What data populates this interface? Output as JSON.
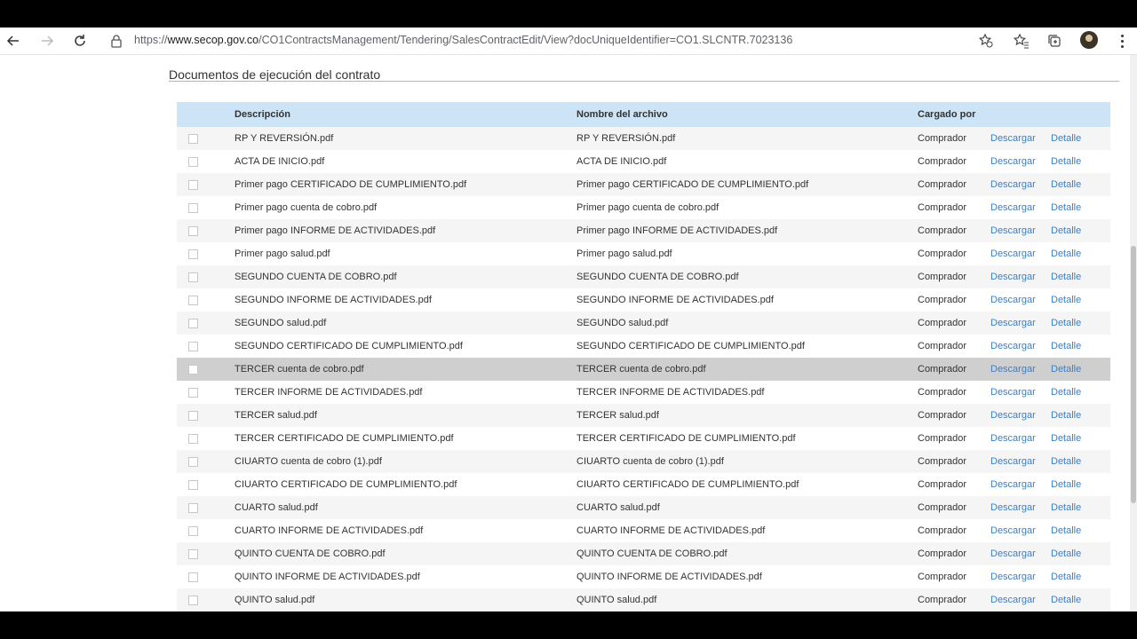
{
  "browser": {
    "url_prefix": "https://",
    "url_host": "www.secop.gov.co",
    "url_path": "/CO1ContractsManagement/Tendering/SalesContractEdit/View?docUniqueIdentifier=CO1.SLCNTR.7023136"
  },
  "section": {
    "title": "Documentos de ejecución del contrato"
  },
  "table": {
    "headers": {
      "description": "Descripción",
      "filename": "Nombre del archivo",
      "uploaded_by": "Cargado por"
    },
    "link_download": "Descargar",
    "link_detail": "Detalle",
    "rows": [
      {
        "description": "RP Y REVERSIÓN.pdf",
        "filename": "RP Y REVERSIÓN.pdf",
        "uploaded_by": "Comprador"
      },
      {
        "description": "ACTA DE INICIO.pdf",
        "filename": "ACTA DE INICIO.pdf",
        "uploaded_by": "Comprador"
      },
      {
        "description": "Primer pago CERTIFICADO DE CUMPLIMIENTO.pdf",
        "filename": "Primer pago CERTIFICADO DE CUMPLIMIENTO.pdf",
        "uploaded_by": "Comprador"
      },
      {
        "description": "Primer pago cuenta de cobro.pdf",
        "filename": "Primer pago cuenta de cobro.pdf",
        "uploaded_by": "Comprador"
      },
      {
        "description": "Primer pago INFORME DE ACTIVIDADES.pdf",
        "filename": "Primer pago INFORME DE ACTIVIDADES.pdf",
        "uploaded_by": "Comprador"
      },
      {
        "description": "Primer pago salud.pdf",
        "filename": "Primer pago salud.pdf",
        "uploaded_by": "Comprador"
      },
      {
        "description": "SEGUNDO CUENTA DE COBRO.pdf",
        "filename": "SEGUNDO CUENTA DE COBRO.pdf",
        "uploaded_by": "Comprador"
      },
      {
        "description": "SEGUNDO INFORME DE ACTIVIDADES.pdf",
        "filename": "SEGUNDO INFORME DE ACTIVIDADES.pdf",
        "uploaded_by": "Comprador"
      },
      {
        "description": "SEGUNDO salud.pdf",
        "filename": "SEGUNDO salud.pdf",
        "uploaded_by": "Comprador"
      },
      {
        "description": "SEGUNDO CERTIFICADO DE CUMPLIMIENTO.pdf",
        "filename": "SEGUNDO CERTIFICADO DE CUMPLIMIENTO.pdf",
        "uploaded_by": "Comprador"
      },
      {
        "description": "TERCER cuenta de cobro.pdf",
        "filename": "TERCER cuenta de cobro.pdf",
        "uploaded_by": "Comprador",
        "highlighted": true
      },
      {
        "description": "TERCER INFORME DE ACTIVIDADES.pdf",
        "filename": "TERCER INFORME DE ACTIVIDADES.pdf",
        "uploaded_by": "Comprador"
      },
      {
        "description": "TERCER salud.pdf",
        "filename": "TERCER salud.pdf",
        "uploaded_by": "Comprador"
      },
      {
        "description": "TERCER CERTIFICADO DE CUMPLIMIENTO.pdf",
        "filename": "TERCER CERTIFICADO DE CUMPLIMIENTO.pdf",
        "uploaded_by": "Comprador"
      },
      {
        "description": "CIUARTO cuenta de cobro (1).pdf",
        "filename": "CIUARTO cuenta de cobro (1).pdf",
        "uploaded_by": "Comprador"
      },
      {
        "description": "CIUARTO CERTIFICADO DE CUMPLIMIENTO.pdf",
        "filename": "CIUARTO CERTIFICADO DE CUMPLIMIENTO.pdf",
        "uploaded_by": "Comprador"
      },
      {
        "description": "CUARTO salud.pdf",
        "filename": "CUARTO salud.pdf",
        "uploaded_by": "Comprador"
      },
      {
        "description": "CUARTO INFORME DE ACTIVIDADES.pdf",
        "filename": "CUARTO INFORME DE ACTIVIDADES.pdf",
        "uploaded_by": "Comprador"
      },
      {
        "description": "QUINTO CUENTA DE COBRO.pdf",
        "filename": "QUINTO CUENTA DE COBRO.pdf",
        "uploaded_by": "Comprador"
      },
      {
        "description": "QUINTO INFORME DE ACTIVIDADES.pdf",
        "filename": "QUINTO INFORME DE ACTIVIDADES.pdf",
        "uploaded_by": "Comprador"
      },
      {
        "description": "QUINTO salud.pdf",
        "filename": "QUINTO salud.pdf",
        "uploaded_by": "Comprador"
      }
    ]
  },
  "colors": {
    "header_bg": "#cde3f6",
    "link": "#3a80c9",
    "highlight_row": "#cfcfcf"
  },
  "icons": [
    "back-arrow-icon",
    "forward-arrow-icon",
    "refresh-icon",
    "lock-icon",
    "favorite-add-icon",
    "favorites-icon",
    "collections-icon",
    "profile-avatar",
    "more-menu-icon"
  ]
}
